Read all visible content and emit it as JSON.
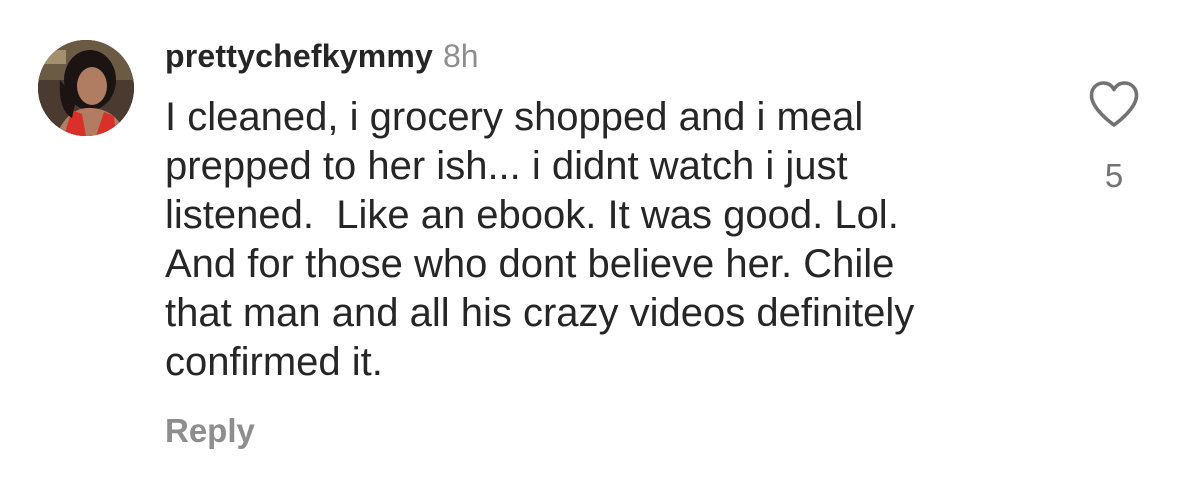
{
  "comment": {
    "avatar_icon": "user-avatar-photo",
    "username": "prettychefkymmy",
    "timestamp": "8h",
    "text_lines": [
      "I cleaned, i grocery shopped and i meal",
      "prepped to her ish... i didnt watch i just",
      "listened.  Like an ebook. It was good. Lol.",
      "And for those who dont believe her. Chile",
      "that man and all his crazy videos definitely",
      "confirmed it."
    ],
    "reply_label": "Reply",
    "like_icon": "heart-outline-icon",
    "like_count": "5"
  },
  "colors": {
    "text_primary": "#262626",
    "text_secondary": "#8e8e8e",
    "background": "#ffffff"
  }
}
